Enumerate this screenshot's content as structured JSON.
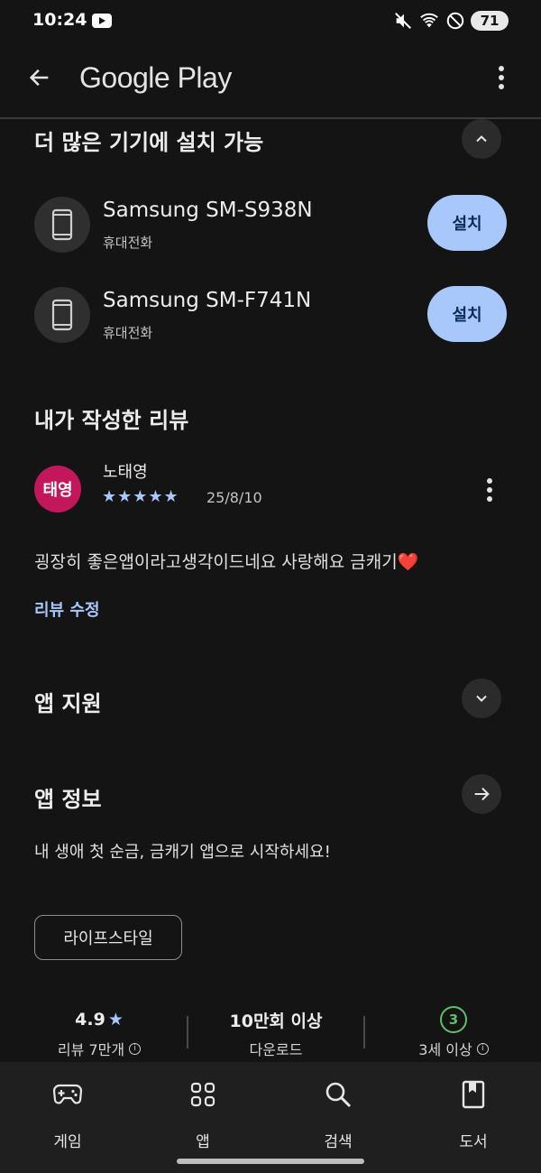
{
  "status_bar": {
    "time": "10:24",
    "battery": "71"
  },
  "app_bar": {
    "title": "Google Play"
  },
  "devices_section": {
    "title": "더 많은 기기에 설치 가능",
    "devices": [
      {
        "name": "Samsung SM-S938N",
        "type": "휴대전화",
        "button": "설치"
      },
      {
        "name": "Samsung SM-F741N",
        "type": "휴대전화",
        "button": "설치"
      }
    ]
  },
  "my_review": {
    "title": "내가 작성한 리뷰",
    "avatar_text": "태영",
    "avatar_color": "#c2185b",
    "reviewer": "노태영",
    "stars": "★★★★★",
    "rating": 5,
    "date": "25/8/10",
    "text": "굉장히 좋은앱이라고생각이드네요 사랑해요 금캐기❤️",
    "edit_label": "리뷰 수정"
  },
  "app_support": {
    "title": "앱 지원"
  },
  "app_info": {
    "title": "앱 정보",
    "description": "내 생애 첫 순금, 금캐기 앱으로 시작하세요!",
    "category": "라이프스타일"
  },
  "stats": {
    "rating": "4.9",
    "rating_star": "★",
    "reviews": "리뷰 7만개",
    "downloads": "10만회 이상",
    "downloads_label": "다운로드",
    "age": "3",
    "age_label": "3세 이상"
  },
  "bottom_nav": [
    {
      "label": "게임",
      "icon": "gamepad-icon"
    },
    {
      "label": "앱",
      "icon": "apps-grid-icon"
    },
    {
      "label": "검색",
      "icon": "search-icon"
    },
    {
      "label": "도서",
      "icon": "book-icon"
    }
  ],
  "colors": {
    "accent": "#a8c7fa",
    "background": "#141414",
    "age_green": "#5fbf6a"
  }
}
